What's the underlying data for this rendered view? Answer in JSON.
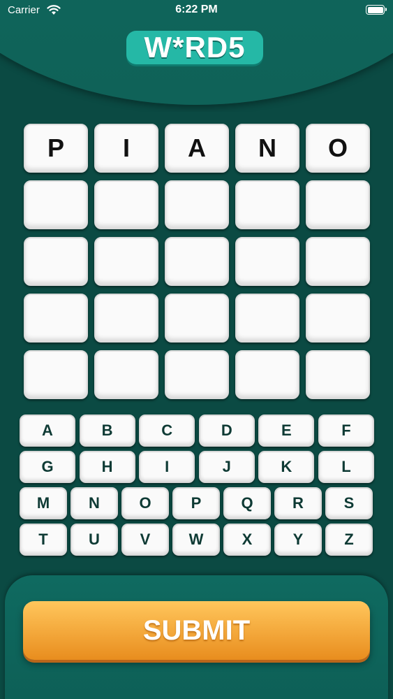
{
  "status_bar": {
    "carrier": "Carrier",
    "time": "6:22 PM"
  },
  "header": {
    "logo_text": "W*RD5"
  },
  "board": {
    "rows": [
      [
        "P",
        "I",
        "A",
        "N",
        "O"
      ],
      [
        "",
        "",
        "",
        "",
        ""
      ],
      [
        "",
        "",
        "",
        "",
        ""
      ],
      [
        "",
        "",
        "",
        "",
        ""
      ],
      [
        "",
        "",
        "",
        "",
        ""
      ]
    ]
  },
  "keyboard": {
    "rows": [
      [
        "A",
        "B",
        "C",
        "D",
        "E",
        "F"
      ],
      [
        "G",
        "H",
        "I",
        "J",
        "K",
        "L"
      ],
      [
        "M",
        "N",
        "O",
        "P",
        "Q",
        "R",
        "S"
      ],
      [
        "T",
        "U",
        "V",
        "W",
        "X",
        "Y",
        "Z"
      ]
    ]
  },
  "footer": {
    "submit_label": "SUBMIT"
  },
  "colors": {
    "background": "#0b4a43",
    "header": "#106a5f",
    "logo": "#25b8a6",
    "submit": "#f3a73a"
  }
}
